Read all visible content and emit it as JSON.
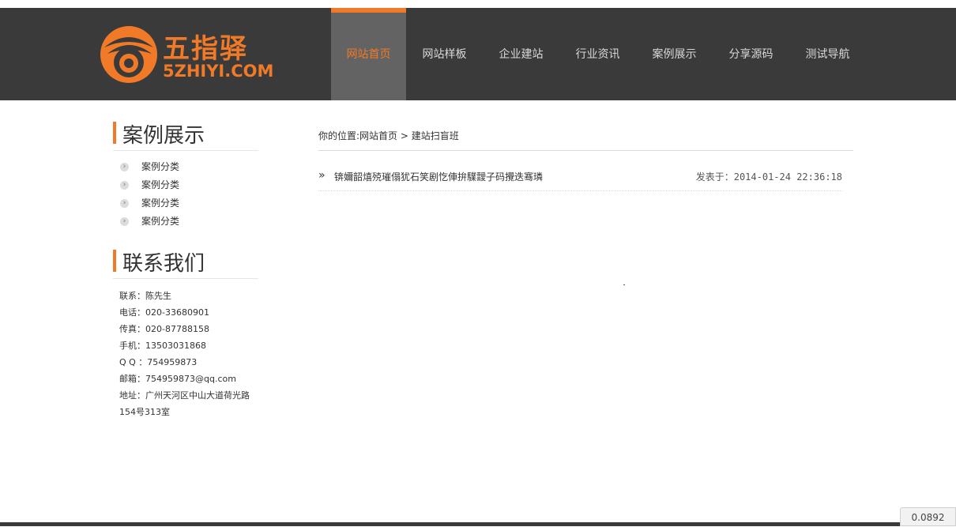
{
  "header": {
    "logo_cn": "五指驿",
    "logo_en": "5ZHIYI.COM"
  },
  "nav": {
    "items": [
      {
        "label": "网站首页",
        "active": true
      },
      {
        "label": "网站样板"
      },
      {
        "label": "企业建站"
      },
      {
        "label": "行业资讯"
      },
      {
        "label": "案例展示"
      },
      {
        "label": "分享源码"
      },
      {
        "label": "测试导航"
      }
    ]
  },
  "sidebar": {
    "cases_title": "案例展示",
    "categories": [
      "案例分类",
      "案例分类",
      "案例分类",
      "案例分类"
    ],
    "contact_title": "联系我们",
    "contact": {
      "person": "联系：陈先生",
      "phone": "电话：020-33680901",
      "fax": "传真：020-87788158",
      "mobile": "手机：13503031868",
      "qq": "Q Q ：754959873",
      "email": "邮箱：754959873@qq.com",
      "address": "地址：广州天河区中山大道荷光路154号313室"
    }
  },
  "breadcrumb": {
    "prefix": "你的位置:",
    "home": "网站首页",
    "separator": " > ",
    "current": "建站扫盲班"
  },
  "articles": [
    {
      "title": "锛嬭韶熺殑璀傝犹石笑剧忔俥拚驜靉子码攪迭骞璘",
      "date": "发表于：2014-01-24 22:36:18"
    }
  ],
  "perf_badge": "0.0892",
  "colors": {
    "accent": "#f07a27",
    "header_bg": "#3a3a3a",
    "nav_active_bg": "#636363"
  },
  "icons": {
    "list_bullet": "chevron-right-icon",
    "article_bullet": "double-chevron-icon"
  }
}
